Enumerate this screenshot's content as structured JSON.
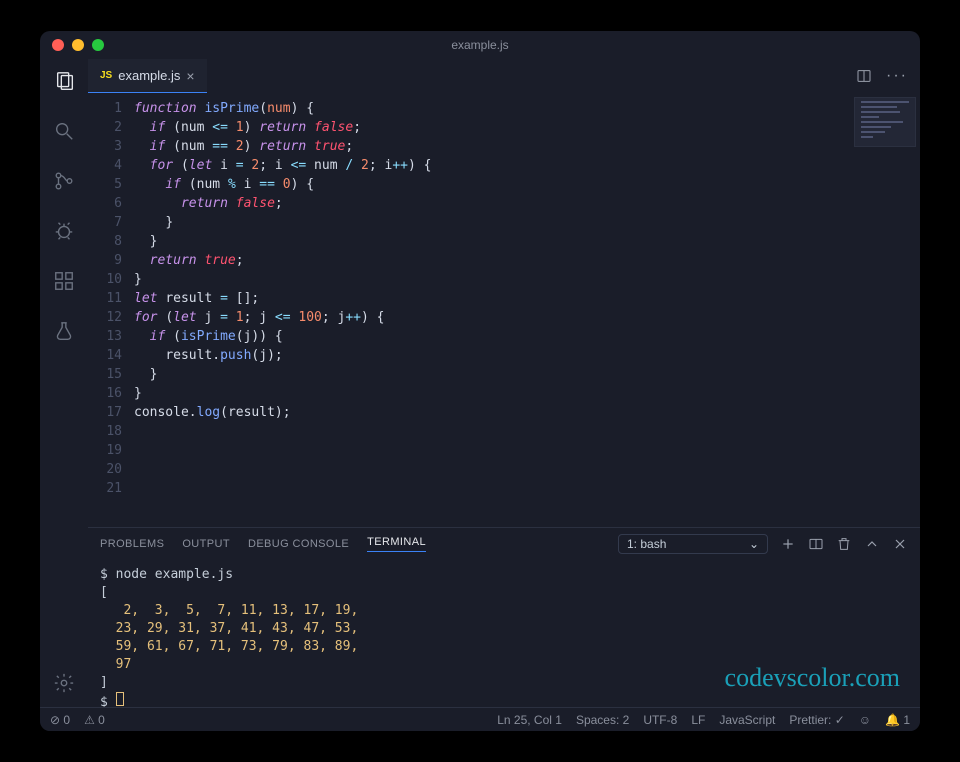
{
  "window": {
    "title": "example.js"
  },
  "tabs": {
    "active": {
      "icon": "JS",
      "label": "example.js"
    }
  },
  "code": {
    "lines": [
      [
        [
          "kw",
          "function"
        ],
        [
          "sp",
          " "
        ],
        [
          "fn",
          "isPrime"
        ],
        [
          "punc",
          "("
        ],
        [
          "param",
          "num"
        ],
        [
          "punc",
          ") {"
        ]
      ],
      [
        [
          "sp",
          "  "
        ],
        [
          "kw",
          "if"
        ],
        [
          "sp",
          " "
        ],
        [
          "punc",
          "("
        ],
        [
          "id",
          "num"
        ],
        [
          "sp",
          " "
        ],
        [
          "op",
          "<="
        ],
        [
          "sp",
          " "
        ],
        [
          "num",
          "1"
        ],
        [
          "punc",
          ") "
        ],
        [
          "kw",
          "return"
        ],
        [
          "sp",
          " "
        ],
        [
          "bool",
          "false"
        ],
        [
          "punc",
          ";"
        ]
      ],
      [
        [
          "sp",
          "  "
        ],
        [
          "kw",
          "if"
        ],
        [
          "sp",
          " "
        ],
        [
          "punc",
          "("
        ],
        [
          "id",
          "num"
        ],
        [
          "sp",
          " "
        ],
        [
          "op",
          "=="
        ],
        [
          "sp",
          " "
        ],
        [
          "num",
          "2"
        ],
        [
          "punc",
          ") "
        ],
        [
          "kw",
          "return"
        ],
        [
          "sp",
          " "
        ],
        [
          "bool",
          "true"
        ],
        [
          "punc",
          ";"
        ]
      ],
      [
        [
          "sp",
          ""
        ]
      ],
      [
        [
          "sp",
          "  "
        ],
        [
          "kw",
          "for"
        ],
        [
          "sp",
          " "
        ],
        [
          "punc",
          "("
        ],
        [
          "kw",
          "let"
        ],
        [
          "sp",
          " "
        ],
        [
          "id",
          "i"
        ],
        [
          "sp",
          " "
        ],
        [
          "op",
          "="
        ],
        [
          "sp",
          " "
        ],
        [
          "num",
          "2"
        ],
        [
          "punc",
          "; "
        ],
        [
          "id",
          "i"
        ],
        [
          "sp",
          " "
        ],
        [
          "op",
          "<="
        ],
        [
          "sp",
          " "
        ],
        [
          "id",
          "num"
        ],
        [
          "sp",
          " "
        ],
        [
          "op",
          "/"
        ],
        [
          "sp",
          " "
        ],
        [
          "num",
          "2"
        ],
        [
          "punc",
          "; "
        ],
        [
          "id",
          "i"
        ],
        [
          "op",
          "++"
        ],
        [
          "punc",
          ") {"
        ]
      ],
      [
        [
          "sp",
          "    "
        ],
        [
          "kw",
          "if"
        ],
        [
          "sp",
          " "
        ],
        [
          "punc",
          "("
        ],
        [
          "id",
          "num"
        ],
        [
          "sp",
          " "
        ],
        [
          "op",
          "%"
        ],
        [
          "sp",
          " "
        ],
        [
          "id",
          "i"
        ],
        [
          "sp",
          " "
        ],
        [
          "op",
          "=="
        ],
        [
          "sp",
          " "
        ],
        [
          "num",
          "0"
        ],
        [
          "punc",
          ") {"
        ]
      ],
      [
        [
          "sp",
          "      "
        ],
        [
          "kw",
          "return"
        ],
        [
          "sp",
          " "
        ],
        [
          "bool",
          "false"
        ],
        [
          "punc",
          ";"
        ]
      ],
      [
        [
          "sp",
          "    "
        ],
        [
          "punc",
          "}"
        ]
      ],
      [
        [
          "sp",
          "  "
        ],
        [
          "punc",
          "}"
        ]
      ],
      [
        [
          "sp",
          "  "
        ],
        [
          "kw",
          "return"
        ],
        [
          "sp",
          " "
        ],
        [
          "bool",
          "true"
        ],
        [
          "punc",
          ";"
        ]
      ],
      [
        [
          "punc",
          "}"
        ]
      ],
      [
        [
          "sp",
          ""
        ]
      ],
      [
        [
          "kw",
          "let"
        ],
        [
          "sp",
          " "
        ],
        [
          "id",
          "result"
        ],
        [
          "sp",
          " "
        ],
        [
          "op",
          "="
        ],
        [
          "sp",
          " "
        ],
        [
          "punc",
          "[];"
        ]
      ],
      [
        [
          "sp",
          ""
        ]
      ],
      [
        [
          "kw",
          "for"
        ],
        [
          "sp",
          " "
        ],
        [
          "punc",
          "("
        ],
        [
          "kw",
          "let"
        ],
        [
          "sp",
          " "
        ],
        [
          "id",
          "j"
        ],
        [
          "sp",
          " "
        ],
        [
          "op",
          "="
        ],
        [
          "sp",
          " "
        ],
        [
          "num",
          "1"
        ],
        [
          "punc",
          "; "
        ],
        [
          "id",
          "j"
        ],
        [
          "sp",
          " "
        ],
        [
          "op",
          "<="
        ],
        [
          "sp",
          " "
        ],
        [
          "num",
          "100"
        ],
        [
          "punc",
          "; "
        ],
        [
          "id",
          "j"
        ],
        [
          "op",
          "++"
        ],
        [
          "punc",
          ") {"
        ]
      ],
      [
        [
          "sp",
          "  "
        ],
        [
          "kw",
          "if"
        ],
        [
          "sp",
          " "
        ],
        [
          "punc",
          "("
        ],
        [
          "fn",
          "isPrime"
        ],
        [
          "punc",
          "("
        ],
        [
          "id",
          "j"
        ],
        [
          "punc",
          ")) {"
        ]
      ],
      [
        [
          "sp",
          "    "
        ],
        [
          "id",
          "result"
        ],
        [
          "punc",
          "."
        ],
        [
          "fn",
          "push"
        ],
        [
          "punc",
          "("
        ],
        [
          "id",
          "j"
        ],
        [
          "punc",
          ");"
        ]
      ],
      [
        [
          "sp",
          "  "
        ],
        [
          "punc",
          "}"
        ]
      ],
      [
        [
          "punc",
          "}"
        ]
      ],
      [
        [
          "sp",
          ""
        ]
      ],
      [
        [
          "id",
          "console"
        ],
        [
          "punc",
          "."
        ],
        [
          "fn",
          "log"
        ],
        [
          "punc",
          "("
        ],
        [
          "id",
          "result"
        ],
        [
          "punc",
          ");"
        ]
      ]
    ]
  },
  "panel": {
    "tabs": [
      "PROBLEMS",
      "OUTPUT",
      "DEBUG CONSOLE",
      "TERMINAL"
    ],
    "active_tab": "TERMINAL",
    "terminal_select": "1: bash",
    "terminal_lines": [
      {
        "p": "$ ",
        "t": "node example.js"
      },
      {
        "p": "",
        "t": "["
      },
      {
        "p": "",
        "y": "   2,  3,  5,  7, 11, 13, 17, 19,"
      },
      {
        "p": "",
        "y": "  23, 29, 31, 37, 41, 43, 47, 53,"
      },
      {
        "p": "",
        "y": "  59, 61, 67, 71, 73, 79, 83, 89,"
      },
      {
        "p": "",
        "y": "  97"
      },
      {
        "p": "",
        "t": "]"
      },
      {
        "p": "$ ",
        "cursor": true
      }
    ]
  },
  "statusbar": {
    "errors": "0",
    "warnings": "0",
    "position": "Ln 25, Col 1",
    "spaces": "Spaces: 2",
    "encoding": "UTF-8",
    "eol": "LF",
    "lang": "JavaScript",
    "prettier": "Prettier: ✓",
    "notifications": "1"
  },
  "watermark": "codevscolor.com"
}
